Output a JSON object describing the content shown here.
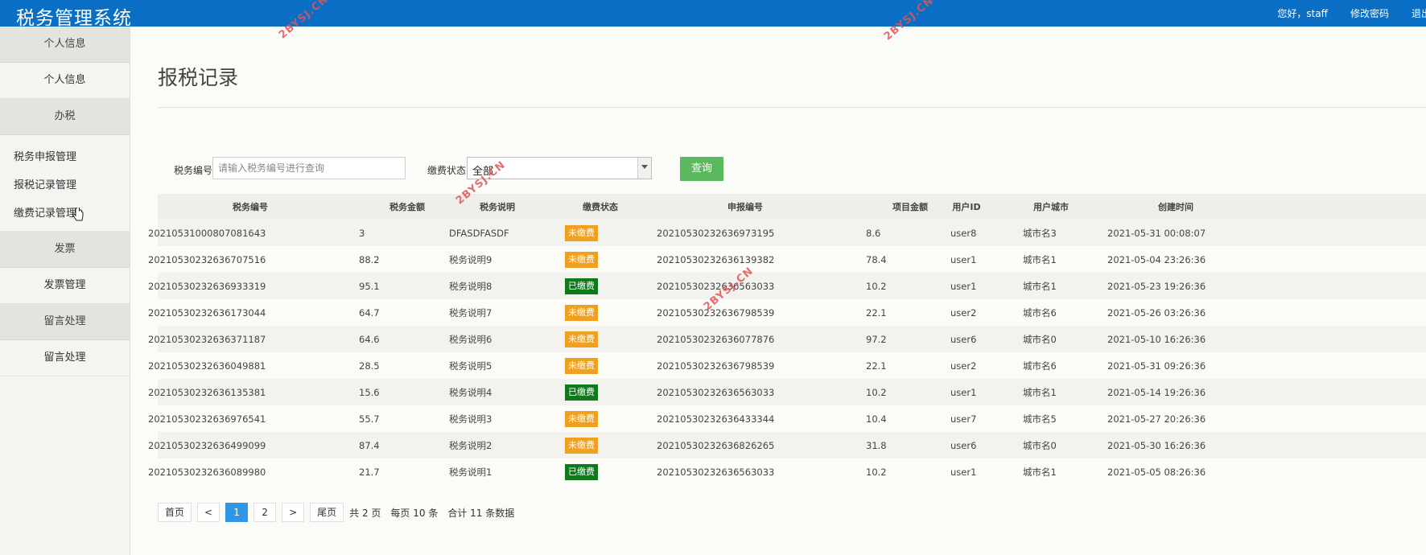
{
  "app": {
    "title": "税务管理系统"
  },
  "topnav": {
    "greeting": "您好，staff",
    "change_password": "修改密码",
    "logout": "退出"
  },
  "sidebar": {
    "sections": [
      {
        "header": "个人信息",
        "items": [
          "个人信息"
        ]
      },
      {
        "header": "办税",
        "items": [
          "税务申报管理",
          "报税记录管理",
          "缴费记录管理"
        ]
      },
      {
        "header": "发票",
        "items": [
          "发票管理"
        ]
      },
      {
        "header": "留言处理",
        "items": [
          "留言处理"
        ]
      }
    ]
  },
  "page": {
    "title": "报税记录"
  },
  "search": {
    "tax_no_label": "税务编号",
    "tax_no_placeholder": "请输入税务编号进行查询",
    "status_label": "缴费状态",
    "status_value": "全部",
    "query_button": "查询"
  },
  "table": {
    "columns": [
      "税务编号",
      "税务金额",
      "税务说明",
      "缴费状态",
      "申报编号",
      "项目金额",
      "用户ID",
      "用户城市",
      "创建时间"
    ],
    "rows": [
      [
        "20210531000807081643",
        "3",
        "DFASDFASDF",
        "未缴费",
        "20210530232636973195",
        "8.6",
        "user8",
        "城市名3",
        "2021-05-31 00:08:07"
      ],
      [
        "20210530232636707516",
        "88.2",
        "税务说明9",
        "未缴费",
        "20210530232636139382",
        "78.4",
        "user1",
        "城市名1",
        "2021-05-04 23:26:36"
      ],
      [
        "20210530232636933319",
        "95.1",
        "税务说明8",
        "已缴费",
        "20210530232636563033",
        "10.2",
        "user1",
        "城市名1",
        "2021-05-23 19:26:36"
      ],
      [
        "20210530232636173044",
        "64.7",
        "税务说明7",
        "未缴费",
        "20210530232636798539",
        "22.1",
        "user2",
        "城市名6",
        "2021-05-26 03:26:36"
      ],
      [
        "20210530232636371187",
        "64.6",
        "税务说明6",
        "未缴费",
        "20210530232636077876",
        "97.2",
        "user6",
        "城市名0",
        "2021-05-10 16:26:36"
      ],
      [
        "20210530232636049881",
        "28.5",
        "税务说明5",
        "未缴费",
        "20210530232636798539",
        "22.1",
        "user2",
        "城市名6",
        "2021-05-31 09:26:36"
      ],
      [
        "20210530232636135381",
        "15.6",
        "税务说明4",
        "已缴费",
        "20210530232636563033",
        "10.2",
        "user1",
        "城市名1",
        "2021-05-14 19:26:36"
      ],
      [
        "20210530232636976541",
        "55.7",
        "税务说明3",
        "未缴费",
        "20210530232636433344",
        "10.4",
        "user7",
        "城市名5",
        "2021-05-27 20:26:36"
      ],
      [
        "20210530232636499099",
        "87.4",
        "税务说明2",
        "未缴费",
        "20210530232636826265",
        "31.8",
        "user6",
        "城市名0",
        "2021-05-30 16:26:36"
      ],
      [
        "20210530232636089980",
        "21.7",
        "税务说明1",
        "已缴费",
        "20210530232636563033",
        "10.2",
        "user1",
        "城市名1",
        "2021-05-05 08:26:36"
      ]
    ]
  },
  "pagination": {
    "first": "首页",
    "prev": "<",
    "pages": [
      "1",
      "2"
    ],
    "current": "1",
    "next": ">",
    "last": "尾页",
    "total_pages": "共 2 页",
    "per_page": "每页 10 条",
    "total": "合计 11 条数据"
  },
  "watermark": "2BYSJ.CN",
  "colors": {
    "topbar": "#0a6ec4",
    "unpaid": "#f0a020",
    "paid": "#0e7a1c",
    "query": "#5cb85c",
    "active_page": "#2f97e6"
  }
}
